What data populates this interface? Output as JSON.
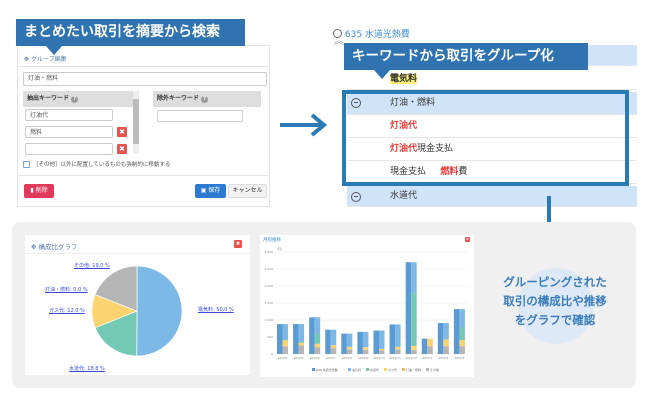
{
  "left_panel": {
    "banner": "まとめたい取引を摘要から検索",
    "title": "グループ編集",
    "group_name": "灯油・燃料",
    "include_header": "抽出キーワード",
    "exclude_header": "除外キーワード",
    "include_keywords": [
      "灯油代",
      "燃料",
      ""
    ],
    "exclude_keywords": [
      ""
    ],
    "checkbox_label": "［その他］以外に配置しているものも強制的に移動する",
    "delete_label": "削除",
    "save_label": "保存",
    "cancel_label": "キャンセル"
  },
  "right_panel": {
    "banner": "キーワードから取引をグループ化",
    "account": "635 水道光熱費",
    "rows": [
      {
        "label": "電気料",
        "type": "highlight"
      },
      {
        "label": "灯油・燃料",
        "type": "group"
      },
      {
        "parts": [
          "灯油代"
        ]
      },
      {
        "parts": [
          "灯油代",
          "現金支払"
        ]
      },
      {
        "parts": [
          "現金支払",
          "燃料",
          "費"
        ]
      },
      {
        "label": "水道代",
        "type": "group"
      }
    ]
  },
  "pie_card": {
    "title": "構成比グラフ"
  },
  "bar_card": {
    "title": "月別推移"
  },
  "callout": [
    "グルーピングされた",
    "取引の構成比や推移",
    "をグラフで確認"
  ],
  "colors": {
    "accent": "#2f73b0",
    "electric": "#7cb9e6",
    "water": "#74c9b4",
    "gas": "#fcd36e",
    "kerosene": "#f5b85a",
    "other": "#b5b5b5",
    "total": "#5b9bd5"
  },
  "chart_data": [
    {
      "type": "pie",
      "title": "構成比グラフ",
      "slices": [
        {
          "label": "電気料: 50.0 %",
          "value": 50.0
        },
        {
          "label": "水道代: 18.8 %",
          "value": 18.8
        },
        {
          "label": "ガス代: 12.0 %",
          "value": 12.0
        },
        {
          "label": "灯油・燃料: 0.0 %",
          "value": 0.0
        },
        {
          "label": "その他: 19.0 %",
          "value": 19.0
        }
      ]
    },
    {
      "type": "bar",
      "title": "月別推移",
      "ylabel": "(円)",
      "ylim": [
        0,
        3000
      ],
      "yticks": [
        "0",
        "500",
        "1,000",
        "1,500",
        "2,000",
        "2,500",
        "3,000"
      ],
      "categories": [
        "2019/4",
        "2019/5",
        "2019/6",
        "2019/7",
        "2019/8",
        "2019/9",
        "2019/10",
        "2019/11",
        "2019/12",
        "2020/1",
        "2020/2",
        "2020/3"
      ],
      "series": [
        {
          "name": "その他",
          "values": [
            225,
            250,
            200,
            170,
            140,
            120,
            110,
            140,
            120,
            230,
            230,
            230
          ]
        },
        {
          "name": "ガス代",
          "values": [
            180,
            80,
            100,
            90,
            70,
            80,
            40,
            70,
            120,
            220,
            200,
            180
          ]
        },
        {
          "name": "水道代",
          "values": [
            20,
            50,
            290,
            0,
            0,
            0,
            0,
            0,
            1550,
            0,
            0,
            370
          ]
        },
        {
          "name": "電気料",
          "values": [
            455,
            500,
            490,
            455,
            390,
            450,
            540,
            660,
            910,
            0,
            480,
            540
          ]
        }
      ],
      "total_series": {
        "name": "635 水道光熱費"
      }
    }
  ]
}
